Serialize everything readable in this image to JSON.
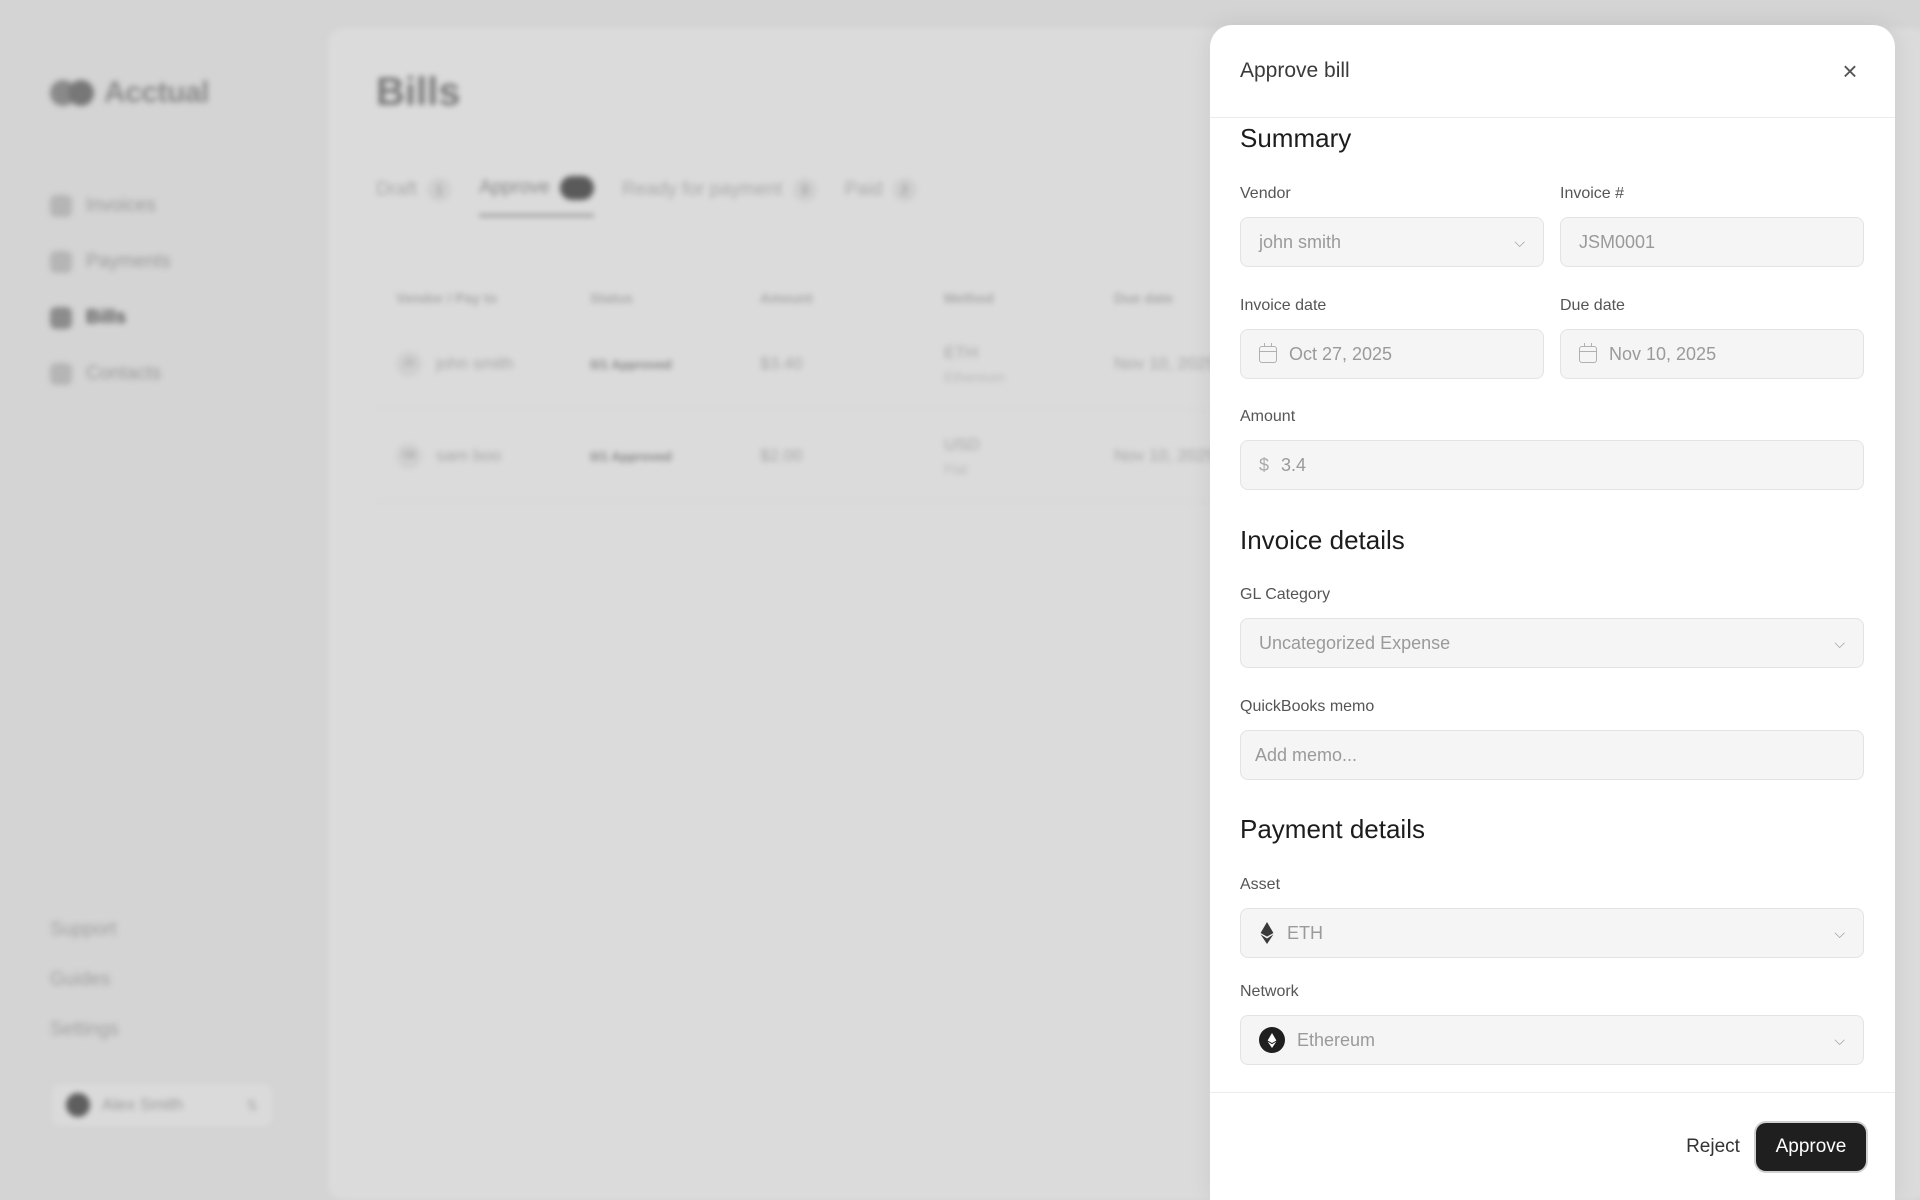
{
  "app": {
    "brand": "Acctual",
    "nav": [
      {
        "label": "Invoices",
        "active": false
      },
      {
        "label": "Payments",
        "active": false
      },
      {
        "label": "Bills",
        "active": true
      },
      {
        "label": "Contacts",
        "active": false
      }
    ],
    "bottom_nav": [
      "Support",
      "Guides",
      "Settings"
    ],
    "user_name": "Alex Smith"
  },
  "bills": {
    "title": "Bills",
    "tabs": [
      {
        "label": "Draft",
        "count": "1",
        "active": false
      },
      {
        "label": "Approve",
        "count": "",
        "active": true
      },
      {
        "label": "Ready for payment",
        "count": "3",
        "active": false
      },
      {
        "label": "Paid",
        "count": "2",
        "active": false
      }
    ],
    "columns": [
      "Vendor / Pay to",
      "Status",
      "Amount",
      "Method",
      "Due date"
    ],
    "rows": [
      {
        "initials": "JS",
        "vendor": "john smith",
        "status": "0/1 Approved",
        "amount": "$3.40",
        "method": "ETH",
        "method_sub": "Ethereum",
        "due": "Nov 10, 2025"
      },
      {
        "initials": "SB",
        "vendor": "sam boo",
        "status": "0/1 Approved",
        "amount": "$2.00",
        "method": "USD",
        "method_sub": "Fiat",
        "due": "Nov 10, 2025"
      }
    ]
  },
  "panel": {
    "title": "Approve bill",
    "close_icon": "close-icon",
    "summary": {
      "title": "Summary",
      "vendor_label": "Vendor",
      "vendor_value": "john smith",
      "invoice_no_label": "Invoice #",
      "invoice_no_value": "JSM0001",
      "invoice_date_label": "Invoice date",
      "invoice_date_value": "Oct 27, 2025",
      "due_date_label": "Due date",
      "due_date_value": "Nov 10, 2025",
      "amount_label": "Amount",
      "amount_currency": "$",
      "amount_value": "3.4"
    },
    "invoice_details": {
      "title": "Invoice details",
      "gl_label": "GL Category",
      "gl_value": "Uncategorized Expense",
      "memo_label": "QuickBooks memo",
      "memo_placeholder": "Add memo..."
    },
    "payment_details": {
      "title": "Payment details",
      "asset_label": "Asset",
      "asset_value": "ETH",
      "network_label": "Network",
      "network_value": "Ethereum"
    },
    "footer": {
      "reject_label": "Reject",
      "approve_label": "Approve"
    }
  },
  "colors": {
    "primary_button": "#1f1f1f",
    "backdrop": "#d4d4d4",
    "field_bg": "#f5f5f5"
  }
}
